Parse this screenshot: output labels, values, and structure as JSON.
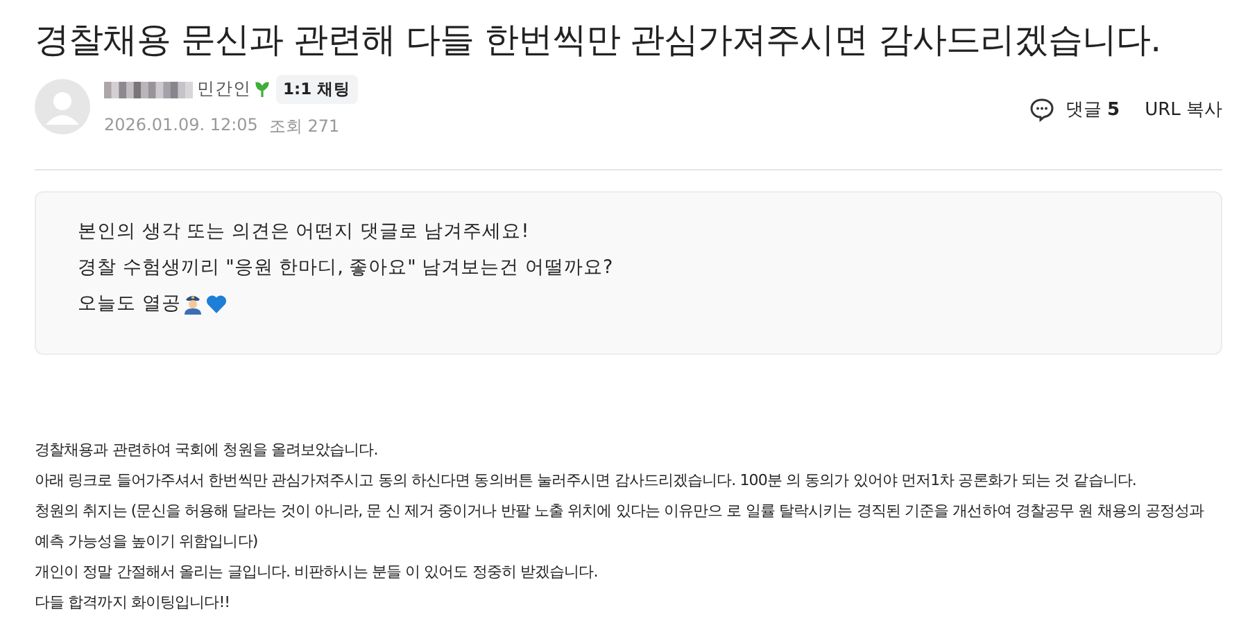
{
  "title": "경찰채용 문신과 관련해 다들 한번씩만 관심가져주시면 감사드리겠습니다.",
  "author": {
    "level": "민간인",
    "chat_button": "1:1 채팅",
    "date": "2026.01.09. 12:05",
    "views": "조회 271"
  },
  "actions": {
    "comments_label": "댓글",
    "comments_count": "5",
    "copy_url": "URL 복사"
  },
  "notice": [
    "본인의 생각 또는 의견은 어떤지 댓글로 남겨주세요!",
    "경찰 수험생끼리 \"응원 한마디, 좋아요\" 남겨보는건 어떨까요?",
    "오늘도 열공"
  ],
  "body": [
    "경찰채용과 관련하여 국회에 청원을 올려보았습니다.",
    "아래 링크로 들어가주셔서 한번씩만 관심가져주시고 동의 하신다면 동의버튼 눌러주시면 감사드리겠습니다. 100분 의 동의가 있어야 먼저1차 공론화가 되는 것 같습니다.",
    "청원의 취지는 (문신을 허용해 달라는 것이 아니라, 문 신 제거 중이거나 반팔 노출 위치에 있다는 이유만으 로 일률 탈락시키는 경직된 기준을 개선하여 경찰공무 원 채용의 공정성과 예측 가능성을 높이기 위함입니다)",
    "개인이 정말 간절해서 올리는 글입니다. 비판하시는 분들 이 있어도 정중히 받겠습니다.",
    "다들 합격까지 화이팅입니다!!"
  ]
}
